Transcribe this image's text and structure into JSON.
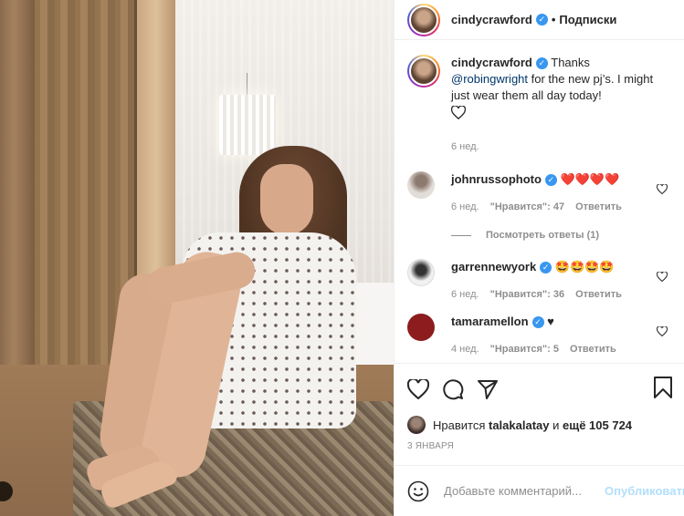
{
  "post": {
    "author": "cindycrawford",
    "header_separator": "•",
    "follow_label": "Подписки",
    "caption": {
      "author": "cindycrawford",
      "text_before": "Thanks ",
      "mention": "@robingwright",
      "text_after": " for the new pj’s. I might just wear them all day today!",
      "time": "6 нед."
    },
    "comments": [
      {
        "author": "johnrussophoto",
        "text": "❤️❤️❤️❤️",
        "time": "6 нед.",
        "likes": "\"Нравится\": 47",
        "reply_label": "Ответить",
        "avatar_color": "#d9d4cf"
      },
      {
        "author": "garrennewyork",
        "text": "🤩🤩🤩🤩",
        "time": "6 нед.",
        "likes": "\"Нравится\": 36",
        "reply_label": "Ответить",
        "avatar_color": "#e8e8e8"
      },
      {
        "author": "tamaramellon",
        "text": "♥",
        "time": "4 нед.",
        "likes": "\"Нравится\": 5",
        "reply_label": "Ответить",
        "avatar_color": "#8c1c1e"
      }
    ],
    "view_replies": "Посмотреть ответы (1)",
    "likes": {
      "prefix": "Нравится ",
      "user": "talakalatay",
      "middle": " и ",
      "others": "ещё 105 724"
    },
    "date": "3 ЯНВАРЯ",
    "add_comment": {
      "placeholder": "Добавьте комментарий...",
      "publish_label": "Опубликовать"
    }
  },
  "colors": {
    "verified": "#3897f0",
    "mention": "#00376b",
    "muted": "#8e8e8e",
    "publish_disabled": "#b2dffc",
    "text": "#262626"
  },
  "icons": [
    "verified-badge-icon",
    "heart-icon",
    "comment-icon",
    "share-icon",
    "bookmark-icon",
    "smile-icon",
    "photo-nav-icon"
  ]
}
